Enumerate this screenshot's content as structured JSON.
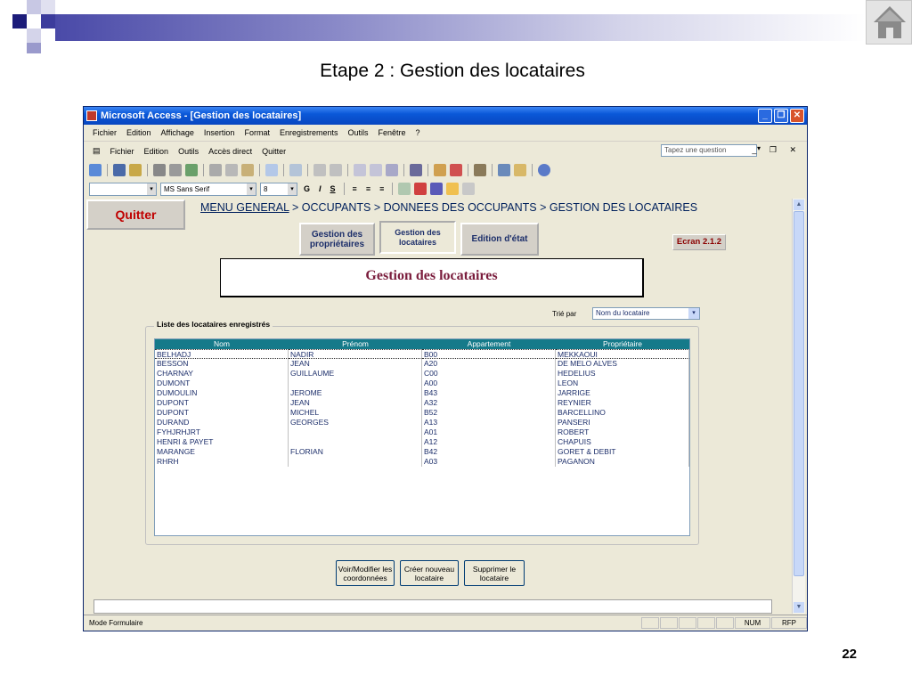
{
  "slide": {
    "title": "Etape 2 : Gestion des locataires",
    "page_number": "22"
  },
  "window": {
    "title": "Microsoft Access - [Gestion des locataires]"
  },
  "menubar": [
    "Fichier",
    "Edition",
    "Affichage",
    "Insertion",
    "Format",
    "Enregistrements",
    "Outils",
    "Fenêtre",
    "?"
  ],
  "menubar2": {
    "items": [
      "Fichier",
      "Edition",
      "Outils",
      "Accès direct",
      "Quitter"
    ],
    "ask_placeholder": "Tapez une question"
  },
  "format_bar": {
    "font": "MS Sans Serif",
    "size": "8",
    "bold": "G",
    "italic": "I",
    "underline": "S"
  },
  "form": {
    "quit_label": "Quitter",
    "breadcrumb_link": "MENU GENERAL",
    "breadcrumb_rest": " > OCCUPANTS > DONNEES DES OCCUPANTS > GESTION DES LOCATAIRES",
    "tabs": [
      {
        "label": "Gestion des propriétaires"
      },
      {
        "label": "Gestion des locataires"
      },
      {
        "label": "Edition d'état"
      }
    ],
    "screen_code": "Ecran 2.1.2",
    "title": "Gestion des locataires",
    "sort_label": "Trié par",
    "sort_value": "Nom du locataire",
    "group_label": "Liste des locataires enregistrés",
    "columns": [
      "Nom",
      "Prénom",
      "Appartement",
      "Propriétaire"
    ],
    "rows": [
      [
        "BELHADJ",
        "NADIR",
        "B00",
        "MEKKAOUI"
      ],
      [
        "BESSON",
        "JEAN",
        "A20",
        "DE MELO ALVES"
      ],
      [
        "CHARNAY",
        "GUILLAUME",
        "C00",
        "HEDELIUS"
      ],
      [
        "DUMONT",
        "",
        "A00",
        "LEON"
      ],
      [
        "DUMOULIN",
        "JEROME",
        "B43",
        "JARRIGE"
      ],
      [
        "DUPONT",
        "JEAN",
        "A32",
        "REYNIER"
      ],
      [
        "DUPONT",
        "MICHEL",
        "B52",
        "BARCELLINO"
      ],
      [
        "DURAND",
        "GEORGES",
        "A13",
        "PANSERI"
      ],
      [
        "FYHJRHJRT",
        "",
        "A01",
        "ROBERT"
      ],
      [
        "HENRI & PAYET",
        "",
        "A12",
        "CHAPUIS"
      ],
      [
        "MARANGE",
        "FLORIAN",
        "B42",
        "GORET & DEBIT"
      ],
      [
        "RHRH",
        "",
        "A03",
        "PAGANON"
      ]
    ],
    "buttons": {
      "view_edit": "Voir/Modifier les coordonnées",
      "create": "Créer nouveau locataire",
      "delete": "Supprimer le locataire"
    }
  },
  "statusbar": {
    "mode": "Mode Formulaire",
    "num": "NUM",
    "rfp": "RFP"
  }
}
